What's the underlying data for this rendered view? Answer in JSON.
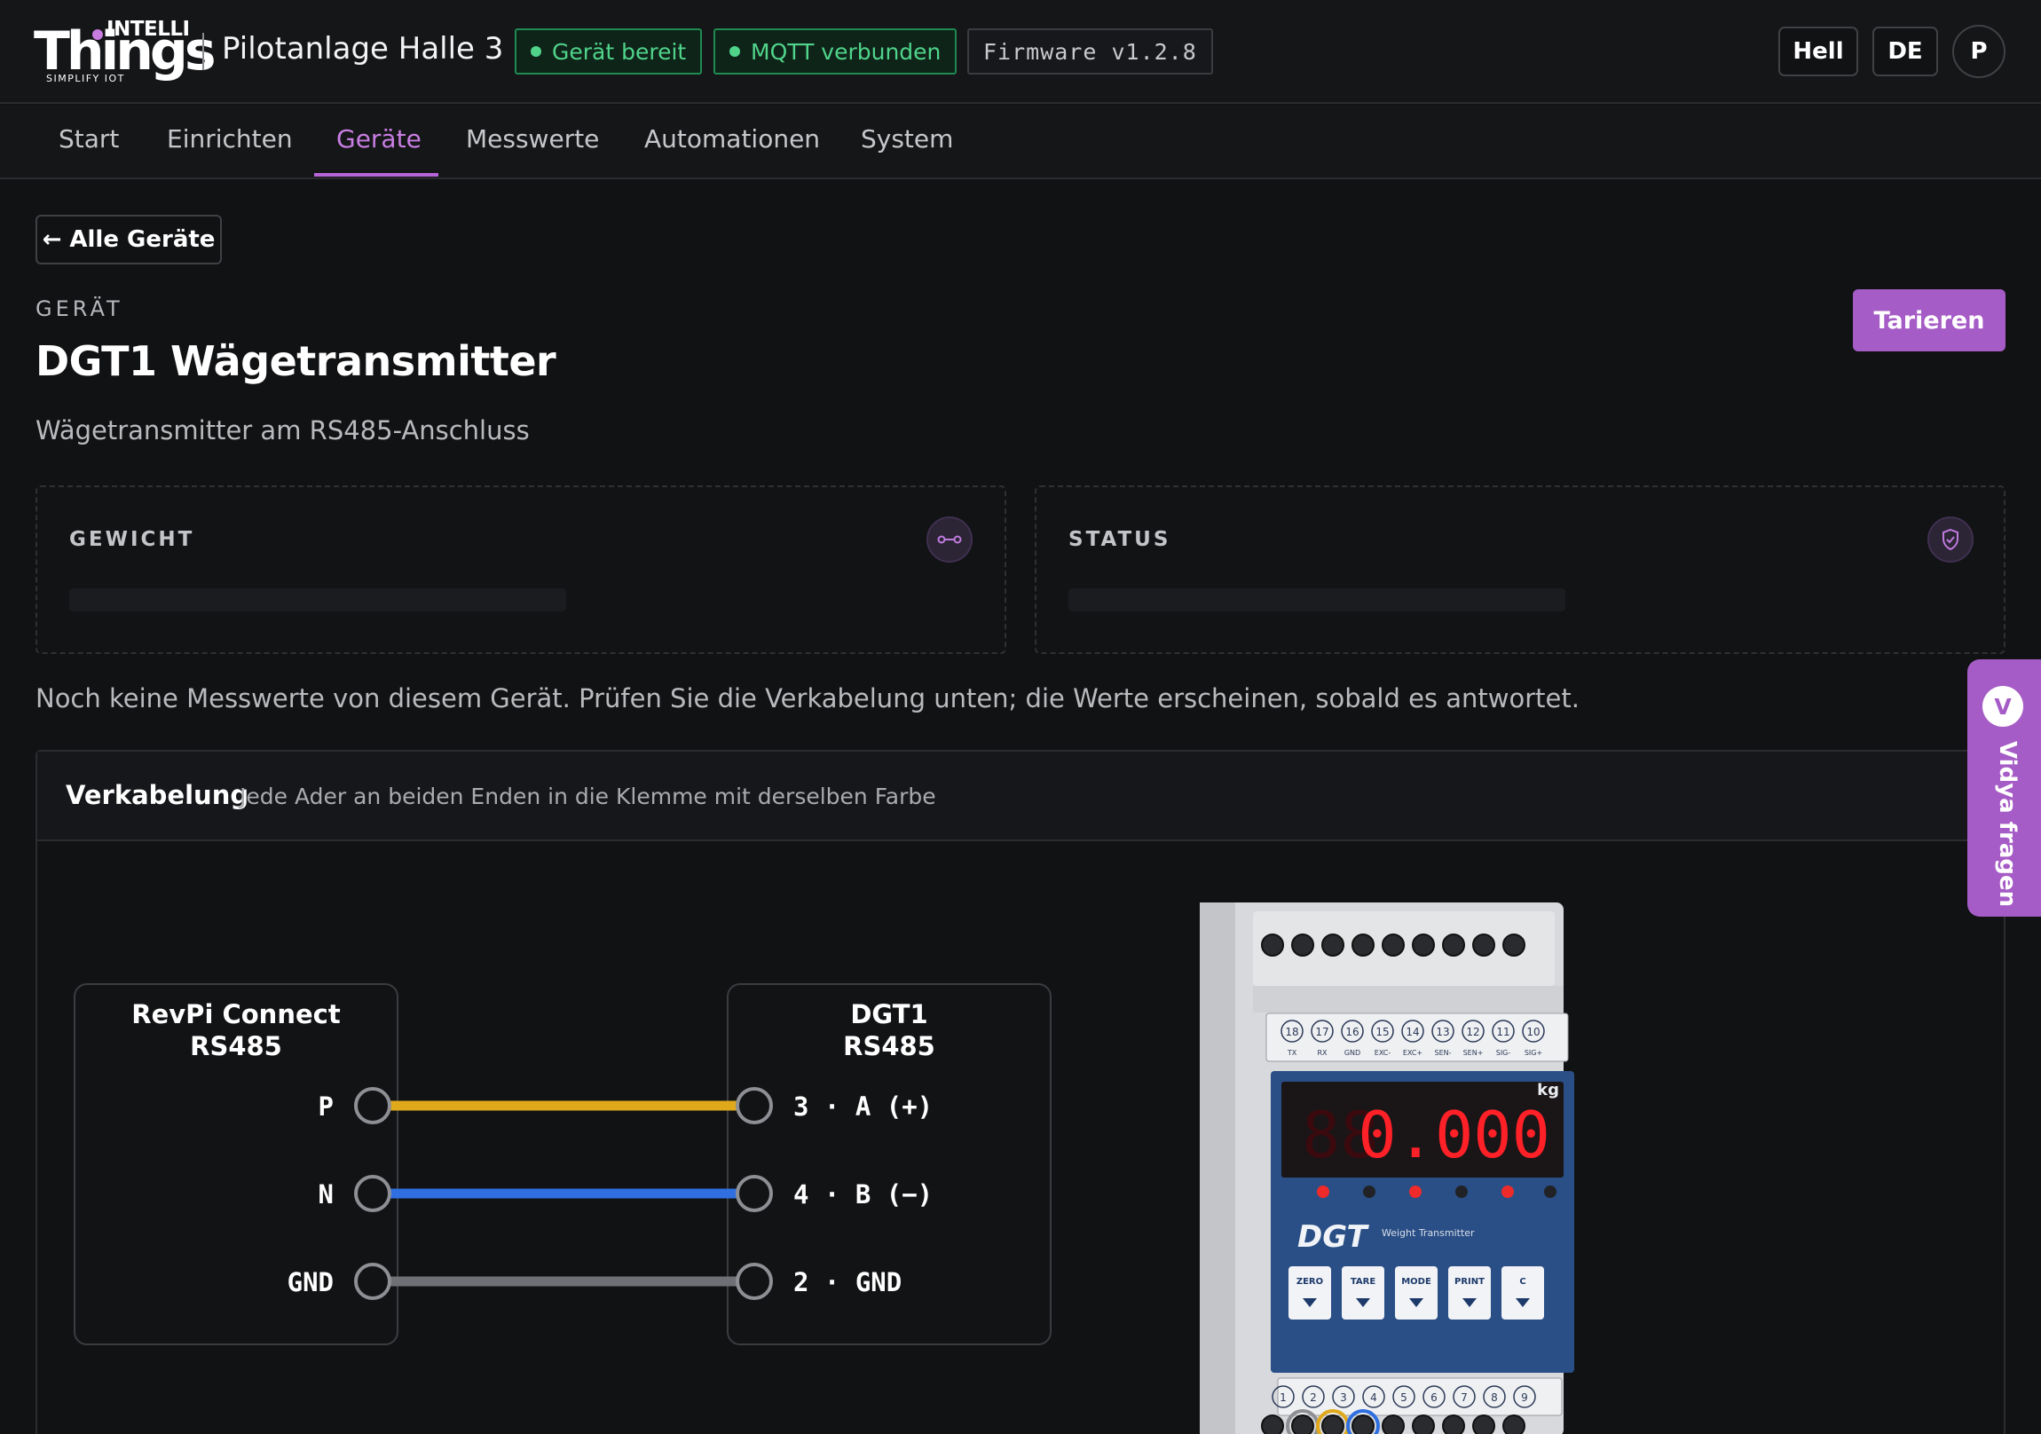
{
  "brand": {
    "intelli": "INTELLI",
    "things": "Things",
    "tagline": "SIMPLIFY IOT"
  },
  "header": {
    "site_title": "Pilotanlage Halle 3",
    "badge_device": "Gerät bereit",
    "badge_mqtt": "MQTT verbunden",
    "firmware": "Firmware v1.2.8",
    "theme_label": "Hell",
    "lang_label": "DE",
    "avatar_initial": "P"
  },
  "nav": {
    "tabs": [
      "Start",
      "Einrichten",
      "Geräte",
      "Messwerte",
      "Automationen",
      "System"
    ],
    "active": "Geräte"
  },
  "main": {
    "back_label": "← Alle Geräte",
    "eyebrow": "GERÄT",
    "title": "DGT1 Wägetransmitter",
    "subtitle": "Wägetransmitter am RS485-Anschluss",
    "tare_label": "Tarieren",
    "cards": [
      {
        "label": "GEWICHT",
        "icon": "link-icon"
      },
      {
        "label": "STATUS",
        "icon": "shield-icon"
      }
    ],
    "hint": "Noch keine Messwerte von diesem Gerät. Prüfen Sie die Verkabelung unten; die Werte erscheinen, sobald es antwortet."
  },
  "wiring": {
    "title": "Verkabelung",
    "subtitle": "Jede Ader an beiden Enden in die Klemme mit derselben Farbe",
    "left_device": {
      "line1": "RevPi Connect",
      "line2": "RS485"
    },
    "right_device": {
      "line1": "DGT1",
      "line2": "RS485"
    },
    "wires": [
      {
        "left": "P",
        "right": "3 · A (+)",
        "color": "#e0a91c"
      },
      {
        "left": "N",
        "right": "4 · B (−)",
        "color": "#2f6fe0"
      },
      {
        "left": "GND",
        "right": "2 · GND",
        "color": "#6e7076"
      }
    ],
    "device_image": {
      "display": "0.000",
      "unit": "kg",
      "brand": "DGT",
      "brand_sub": "Weight Transmitter",
      "buttons": [
        "ZERO",
        "TARE",
        "MODE",
        "PRINT",
        "C"
      ],
      "top_terminals": [
        "18",
        "17",
        "16",
        "15",
        "14",
        "13",
        "12",
        "11",
        "10"
      ],
      "top_terminal_labels": [
        "TX",
        "RX",
        "GND",
        "EXC-",
        "EXC+",
        "SEN-",
        "SEN+",
        "SIG-",
        "SIG+"
      ],
      "bottom_terminals": [
        "1",
        "2",
        "3",
        "4",
        "5",
        "6",
        "7",
        "8",
        "9"
      ]
    }
  },
  "assistant": {
    "initial": "V",
    "label": "Vidya fragen"
  }
}
